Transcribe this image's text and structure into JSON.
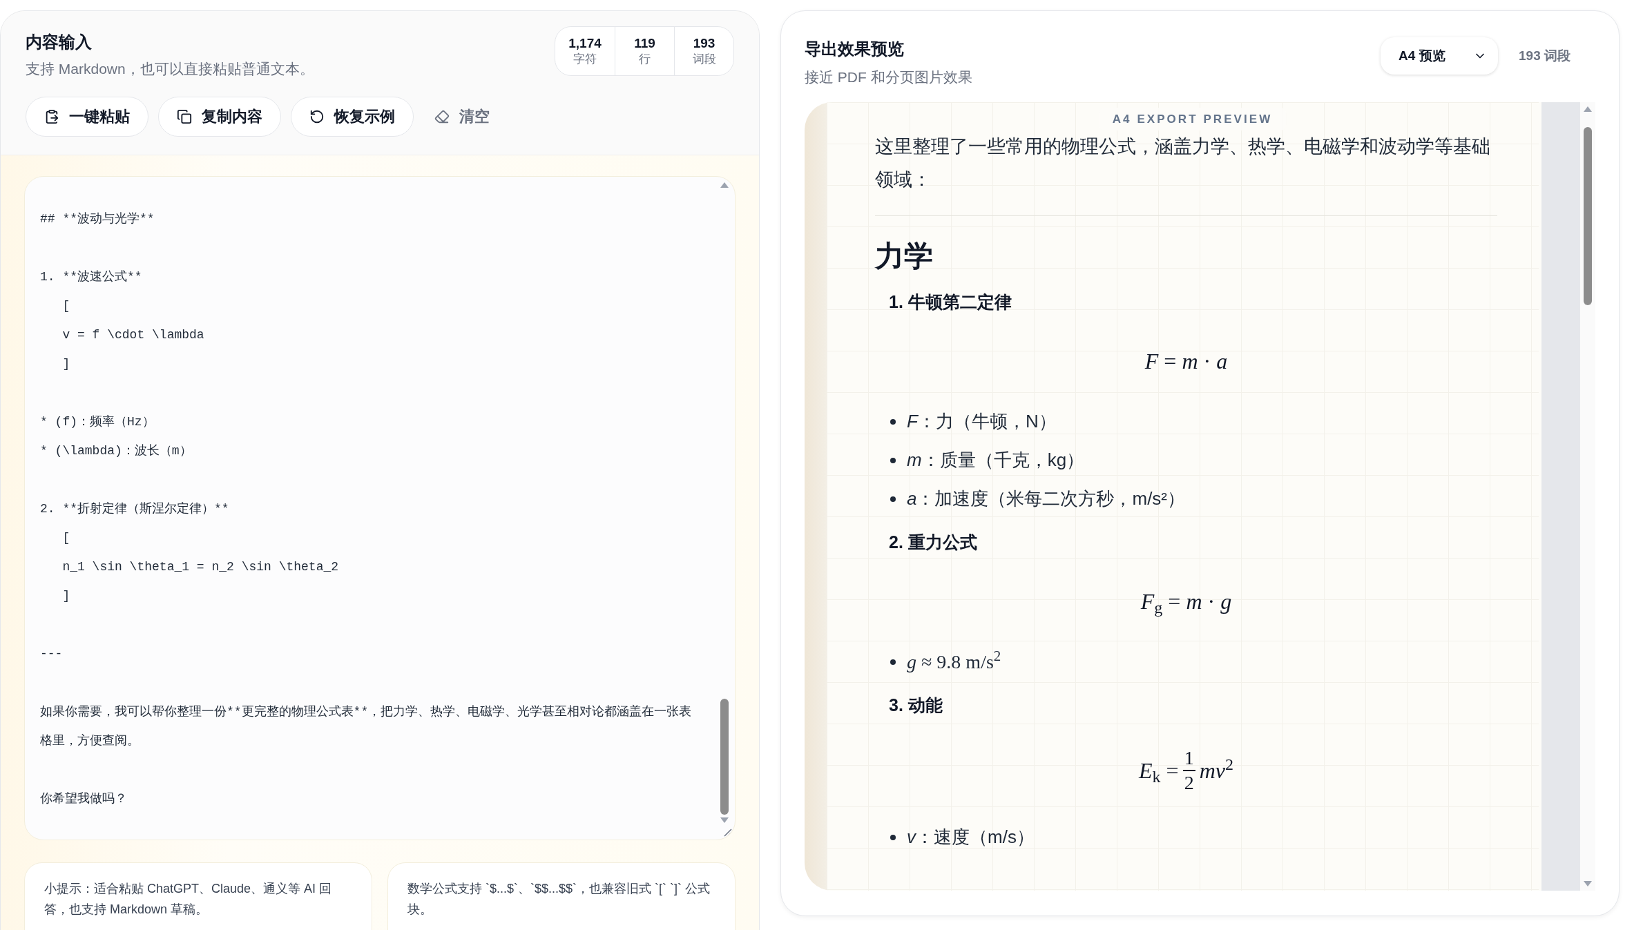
{
  "input_panel": {
    "title": "内容输入",
    "subtitle": "支持 Markdown，也可以直接粘贴普通文本。",
    "stats": [
      {
        "value": "1,174",
        "label": "字符"
      },
      {
        "value": "119",
        "label": "行"
      },
      {
        "value": "193",
        "label": "词段"
      }
    ],
    "actions": [
      {
        "label": "一键粘贴",
        "kind": "paste"
      },
      {
        "label": "复制内容",
        "kind": "copy"
      },
      {
        "label": "恢复示例",
        "kind": "restore"
      },
      {
        "label": "清空",
        "kind": "clear"
      }
    ],
    "editor": {
      "blocks": [
        [
          "## **波动与光学**"
        ],
        [
          "1. **波速公式**",
          "   [",
          "   v = f \\cdot \\lambda",
          "   ]"
        ],
        [
          "* (f)：频率（Hz）",
          "* (\\lambda)：波长（m）"
        ],
        [
          "2. **折射定律（斯涅尔定律）**",
          "   [",
          "   n_1 \\sin \\theta_1 = n_2 \\sin \\theta_2",
          "   ]"
        ],
        [
          "---"
        ],
        [
          "如果你需要，我可以帮你整理一份**更完整的物理公式表**，把力学、热学、电磁学、光学甚至相对论都涵盖在一张表格里，方便查阅。"
        ],
        [
          "你希望我做吗？"
        ]
      ]
    },
    "tips": [
      "小提示：适合粘贴 ChatGPT、Claude、通义等 AI 回答，也支持 Markdown 草稿。",
      "数学公式支持 `$...$`、`$$...$$`，也兼容旧式 `[` `]` 公式块。"
    ]
  },
  "preview_panel": {
    "title": "导出效果预览",
    "subtitle": "接近 PDF 和分页图片效果",
    "select": {
      "value": "A4 预览"
    },
    "count": "193 词段",
    "badge": "A4 EXPORT PREVIEW",
    "content": [
      {
        "kind": "paragraph",
        "text": "这里整理了一些常用的物理公式，涵盖力学、热学、电磁学和波动学等基础领域："
      },
      {
        "kind": "rule"
      },
      {
        "kind": "heading",
        "text": "力学"
      },
      {
        "kind": "item_title",
        "text": "1. 牛顿第二定律"
      },
      {
        "kind": "formula",
        "text": "*F* = *m* · *a*"
      },
      {
        "kind": "bullet",
        "text": "*F*：力（牛顿，N）"
      },
      {
        "kind": "bullet",
        "text": "*m*：质量（千克，kg）"
      },
      {
        "kind": "bullet",
        "text": "*a*：加速度（米每二次方秒，m/s²）"
      },
      {
        "kind": "item_title",
        "text": "2. 重力公式"
      },
      {
        "kind": "formula",
        "text": "*F*$_{g}$ = *m* · *g*"
      },
      {
        "kind": "math_bullet",
        "text": "*g* ≈ 9.8 m/s$^{2}$"
      },
      {
        "kind": "item_title",
        "text": "3. 动能"
      },
      {
        "kind": "fraction_formula",
        "lhs": "*E*$_{k}$ =",
        "numerator": "1",
        "denominator": "2",
        "rhs": "*mv*$^{2}$"
      },
      {
        "kind": "bullet",
        "text": "*v*：速度（m/s）"
      }
    ]
  }
}
